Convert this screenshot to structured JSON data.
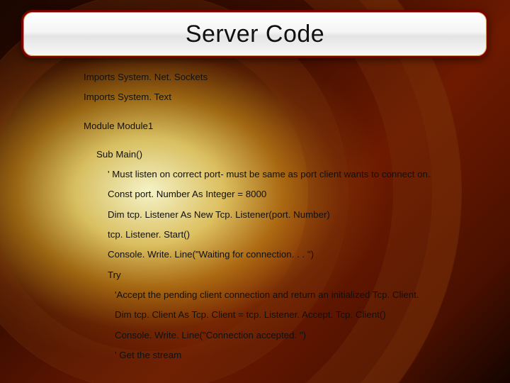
{
  "title": "Server Code",
  "code": {
    "l1": "Imports System. Net. Sockets",
    "l2": "Imports System. Text",
    "l3": "Module Module1",
    "l4": "Sub Main()",
    "l5": "' Must listen on correct port- must be same as port client wants to connect on.",
    "l6": "Const port. Number As Integer = 8000",
    "l7": "Dim tcp. Listener As New Tcp. Listener(port. Number)",
    "l8": "tcp. Listener. Start()",
    "l9": "Console. Write. Line(\"Waiting for connection. . . \")",
    "l10": "Try",
    "l11": "'Accept the pending client connection and return an initialized Tcp. Client.",
    "l12": "Dim tcp. Client As Tcp. Client = tcp. Listener. Accept. Tcp. Client()",
    "l13": "Console. Write. Line(\"Connection accepted. \")",
    "l14": "' Get the stream"
  }
}
